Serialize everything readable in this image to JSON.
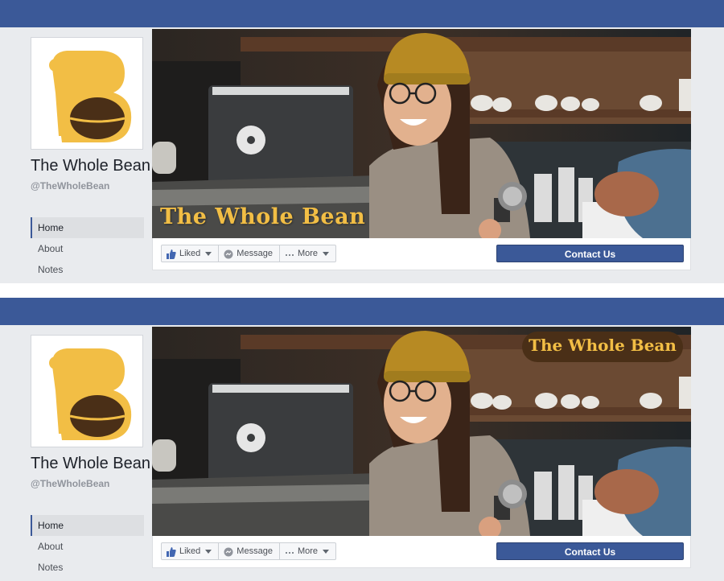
{
  "colors": {
    "fb_blue": "#3b5998",
    "background": "#e9ebee",
    "logo_yellow": "#f2be45",
    "logo_brown": "#4a2f17"
  },
  "logo": {
    "letter": "B"
  },
  "panels": [
    {
      "page_name": "The Whole Bean",
      "handle": "@TheWholeBean",
      "nav": [
        "Home",
        "About",
        "Notes"
      ],
      "active_nav": "Home",
      "cover_title": "The Whole Bean",
      "cover_title_style": "bottom-left-text",
      "buttons": {
        "liked": "Liked",
        "message": "Message",
        "more": "More",
        "contact": "Contact Us"
      },
      "icons": [
        "thumbs-up-icon",
        "message-icon",
        "ellipsis-icon",
        "caret-down-icon"
      ]
    },
    {
      "page_name": "The Whole Bean",
      "handle": "@TheWholeBean",
      "nav": [
        "Home",
        "About",
        "Notes"
      ],
      "active_nav": "Home",
      "cover_title": "The Whole Bean",
      "cover_title_style": "top-right-badge",
      "buttons": {
        "liked": "Liked",
        "message": "Message",
        "more": "More",
        "contact": "Contact Us"
      },
      "icons": [
        "thumbs-up-icon",
        "message-icon",
        "ellipsis-icon",
        "caret-down-icon"
      ]
    }
  ]
}
